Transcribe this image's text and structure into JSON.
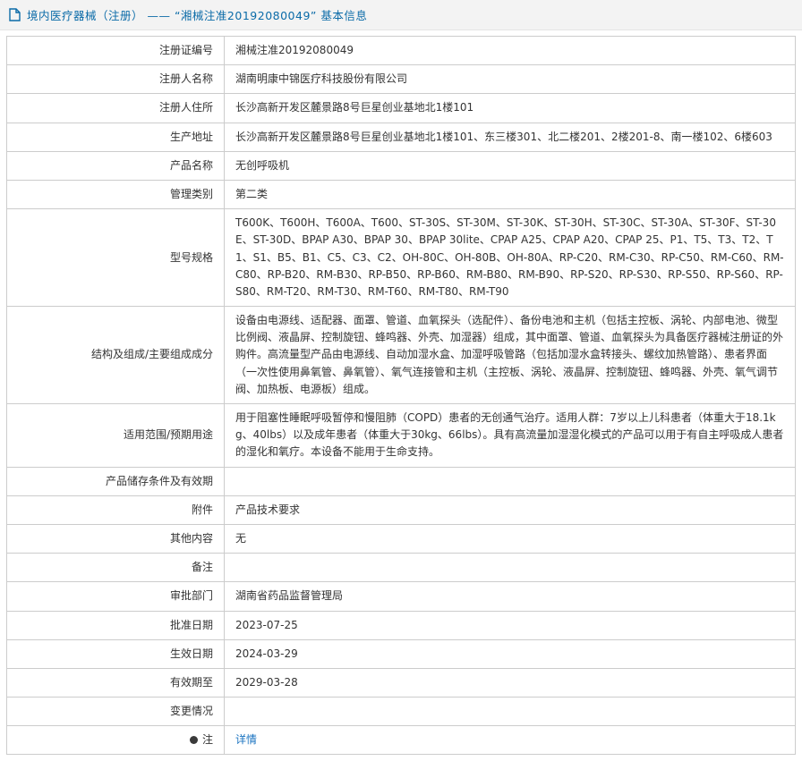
{
  "header": {
    "icon": "document-icon",
    "title": "境内医疗器械（注册） ——  “湘械注准20192080049” 基本信息"
  },
  "colors": {
    "accent_blue": "#0b6ba8",
    "link_blue": "#1a73c0",
    "border_gray": "#cccccc",
    "header_bg": "#f3f3f3"
  },
  "table": {
    "rows": [
      {
        "label": "注册证编号",
        "value": "湘械注准20192080049"
      },
      {
        "label": "注册人名称",
        "value": "湖南明康中锦医疗科技股份有限公司"
      },
      {
        "label": "注册人住所",
        "value": "长沙高新开发区麓景路8号巨星创业基地北1楼101"
      },
      {
        "label": "生产地址",
        "value": "长沙高新开发区麓景路8号巨星创业基地北1楼101、东三楼301、北二楼201、2楼201-8、南一楼102、6楼603"
      },
      {
        "label": "产品名称",
        "value": "无创呼吸机"
      },
      {
        "label": "管理类别",
        "value": "第二类"
      },
      {
        "label": "型号规格",
        "value": "T600K、T600H、T600A、T600、ST-30S、ST-30M、ST-30K、ST-30H、ST-30C、ST-30A、ST-30F、ST-30E、ST-30D、BPAP A30、BPAP 30、BPAP 30lite、CPAP A25、CPAP A20、CPAP 25、P1、T5、T3、T2、T1、S1、B5、B1、C5、C3、C2、OH-80C、OH-80B、OH-80A、RP-C20、RM-C30、RP-C50、RM-C60、RM-C80、RP-B20、RM-B30、RP-B50、RP-B60、RM-B80、RM-B90、RP-S20、RP-S30、RP-S50、RP-S60、RP-S80、RM-T20、RM-T30、RM-T60、RM-T80、RM-T90"
      },
      {
        "label": "结构及组成/主要组成成分",
        "value": "设备由电源线、适配器、面罩、管道、血氧探头（选配件）、备份电池和主机（包括主控板、涡轮、内部电池、微型比例阀、液晶屏、控制旋钮、蜂鸣器、外壳、加湿器）组成，其中面罩、管道、血氧探头为具备医疗器械注册证的外购件。高流量型产品由电源线、自动加湿水盒、加湿呼吸管路（包括加湿水盒转接头、螺纹加热管路）、患者界面（一次性使用鼻氧管、鼻氧管）、氧气连接管和主机（主控板、涡轮、液晶屏、控制旋钮、蜂鸣器、外壳、氧气调节阀、加热板、电源板）组成。"
      },
      {
        "label": "适用范围/预期用途",
        "value": "用于阻塞性睡眠呼吸暂停和慢阻肺（COPD）患者的无创通气治疗。适用人群：7岁以上儿科患者（体重大于18.1kg、40lbs）以及成年患者（体重大于30kg、66lbs）。具有高流量加湿湿化模式的产品可以用于有自主呼吸成人患者的湿化和氧疗。本设备不能用于生命支持。"
      },
      {
        "label": "产品储存条件及有效期",
        "value": ""
      },
      {
        "label": "附件",
        "value": "产品技术要求"
      },
      {
        "label": "其他内容",
        "value": "无"
      },
      {
        "label": "备注",
        "value": ""
      },
      {
        "label": "审批部门",
        "value": "湖南省药品监督管理局"
      },
      {
        "label": "批准日期",
        "value": "2023-07-25"
      },
      {
        "label": "生效日期",
        "value": "2024-03-29"
      },
      {
        "label": "有效期至",
        "value": "2029-03-28"
      },
      {
        "label": "变更情况",
        "value": ""
      }
    ]
  },
  "note_row": {
    "label": "注",
    "link_label": "详情"
  }
}
